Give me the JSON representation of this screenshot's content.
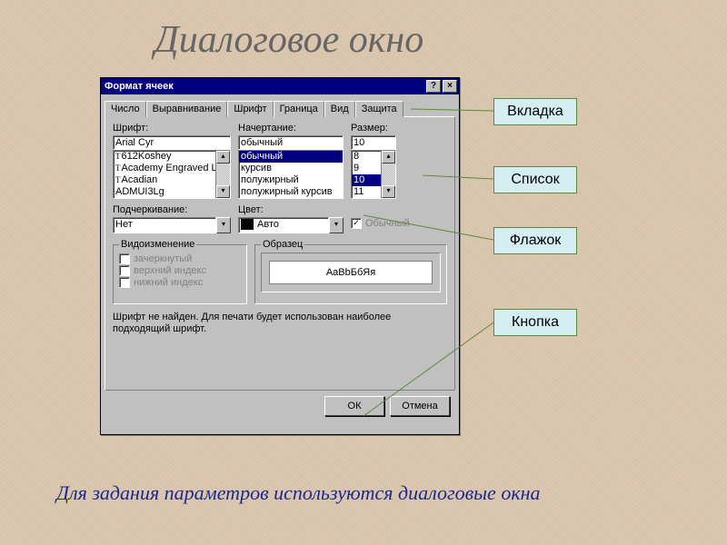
{
  "slide": {
    "title": "Диалоговое окно",
    "footer": "Для задания параметров используются диалоговые окна"
  },
  "dialog": {
    "title": "Формат ячеек",
    "help_btn": "?",
    "close_btn": "×",
    "tabs": [
      "Число",
      "Выравнивание",
      "Шрифт",
      "Граница",
      "Вид",
      "Защита"
    ],
    "font_label": "Шрифт:",
    "style_label": "Начертание:",
    "size_label": "Размер:",
    "font_value": "Arial Cyr",
    "style_value": "обычный",
    "size_value": "10",
    "font_list": [
      "612Koshey",
      "Academy Engraved LET",
      "Acadian",
      "ADMUI3Lg"
    ],
    "style_list": [
      "обычный",
      "курсив",
      "полужирный",
      "полужирный курсив"
    ],
    "size_list": [
      "8",
      "9",
      "10",
      "11"
    ],
    "underline_label": "Подчеркивание:",
    "underline_value": "Нет",
    "color_label": "Цвет:",
    "color_value": "Авто",
    "normal_checkbox": "Обычный",
    "effects_legend": "Видоизменение",
    "effects": [
      "зачеркнутый",
      "верхний индекс",
      "нижний индекс"
    ],
    "preview_legend": "Образец",
    "preview_text": "AaBbБбЯя",
    "note": "Шрифт не найден. Для печати будет использован наиболее подходящий шрифт.",
    "ok": "ОК",
    "cancel": "Отмена"
  },
  "labels": {
    "tab": "Вкладка",
    "list": "Список",
    "checkbox": "Флажок",
    "button": "Кнопка"
  }
}
